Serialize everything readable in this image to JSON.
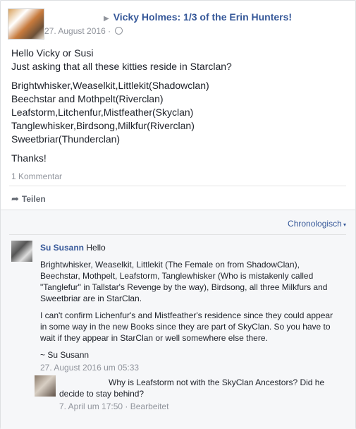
{
  "post": {
    "title": "Vicky Holmes: 1/3 of the Erin Hunters!",
    "date": "27. August 2016",
    "separator": "·",
    "body": [
      "Hello Vicky or Susi",
      "Just asking that all these kitties reside in Starclan?",
      "",
      "Brightwhisker,Weaselkit,Littlekit(Shadowclan)",
      "Beechstar and Mothpelt(Riverclan)",
      "Leafstorm,Litchenfur,Mistfeather(Skyclan)",
      "Tanglewhisker,Birdsong,Milkfur(Riverclan)",
      "Sweetbriar(Thunderclan)",
      "",
      "Thanks!"
    ],
    "comment_count": "1 Kommentar",
    "share_label": "Teilen"
  },
  "comments": {
    "sort_label": "Chronologisch",
    "first": {
      "author": "Su Susann",
      "greeting": "Hello",
      "para1": "Brightwhisker, Weaselkit, Littlekit (The Female on from ShadowClan), Beechstar, Mothpelt, Leafstorm, Tanglewhisker (Who is mistakenly called \"Tanglefur\" in Tallstar's Revenge by the way), Birdsong, all three Milkfurs and Sweetbriar are in StarClan.",
      "para2": "I can't confirm Lichenfur's and Mistfeather's residence since they could appear in some way in the new Books since they are part of SkyClan. So you have to wait if they appear in StarClan or well somewhere else there.",
      "signature": "~ Su Susann",
      "time": "27. August 2016 um 05:33"
    },
    "reply": {
      "text": "Why is Leafstorm not with the SkyClan Ancestors? Did he decide to stay behind?",
      "time": "7. April um 17:50",
      "edited": "Bearbeitet"
    }
  }
}
